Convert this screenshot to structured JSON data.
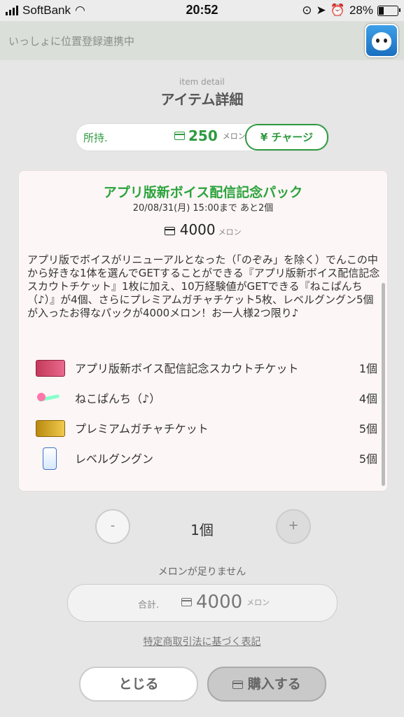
{
  "status_bar": {
    "carrier": "SoftBank",
    "time": "20:52",
    "battery": "28%",
    "battery_level": 0.28
  },
  "notification": {
    "text": "いっしょに位置登録連携中"
  },
  "page": {
    "subtitle": "item detail",
    "title": "アイテム詳細"
  },
  "wallet": {
    "label": "所持.",
    "amount": "250",
    "unit": "メロン",
    "charge_label": "¥ チャージ"
  },
  "pack": {
    "title": "アプリ版新ボイス配信記念パック",
    "date": "20/08/31(月) 15:00まで あと2個",
    "price": "4000",
    "price_unit": "メロン",
    "description": "アプリ版でボイスがリニューアルとなった（「のぞみ」を除く）でんこの中から好きな1体を選んでGETすることができる『アプリ版新ボイス配信記念スカウトチケット』1枚に加え、10万経験値がGETできる『ねこぱんち（♪）』が4個、さらにプレミアムガチャチケット5枚、レベルグングン5個が入ったお得なパックが4000メロン！お一人様2つ限り♪",
    "items": [
      {
        "name": "アプリ版新ボイス配信記念スカウトチケット",
        "qty": "1個"
      },
      {
        "name": "ねこぱんち（♪）",
        "qty": "4個"
      },
      {
        "name": "プレミアムガチャチケット",
        "qty": "5個"
      },
      {
        "name": "レベルグングン",
        "qty": "5個"
      }
    ]
  },
  "purchase": {
    "minus_label": "-",
    "plus_label": "+",
    "quantity": "1個",
    "warning": "メロンが足りません",
    "total_label": "合計.",
    "total_amount": "4000",
    "total_unit": "メロン",
    "legal_link": "特定商取引法に基づく表記",
    "close_label": "とじる",
    "buy_label": "購入する"
  }
}
